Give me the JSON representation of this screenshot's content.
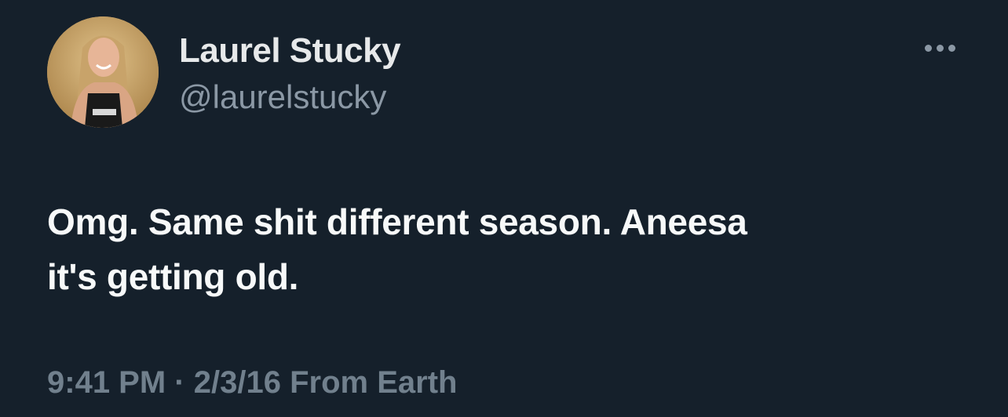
{
  "tweet": {
    "author": {
      "display_name": "Laurel Stucky",
      "handle": "@laurelstucky",
      "avatar_icon": "profile-photo"
    },
    "more_icon": "more-horizontal-icon",
    "text_line1": "Omg. Same shit different season. Aneesa",
    "text_line2": "it's getting old.",
    "time": "9:41 PM",
    "separator": "·",
    "date": "2/3/16",
    "source": "From Earth"
  },
  "colors": {
    "background": "#15202b",
    "primary_text": "#f7f9f9",
    "secondary_text": "#8b98a5",
    "meta_text": "#71808d"
  }
}
